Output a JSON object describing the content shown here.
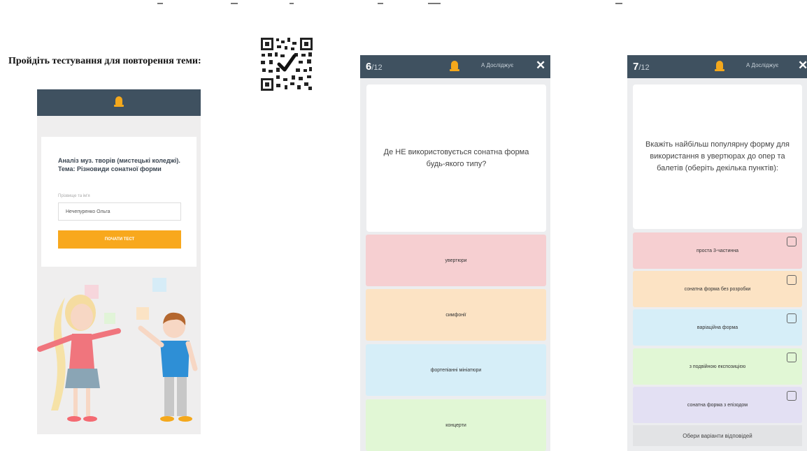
{
  "intro": {
    "text": "Пройдіть тестування для повторення теми:"
  },
  "start_screen": {
    "test_title": "Аналіз муз. творів (мистецькі коледжі). Тема: Різновиди сонатної форми",
    "name_label": "Прізвище та ім'я",
    "name_value": "Нечепуренко Ольга",
    "start_button": "Почати тест"
  },
  "quiz6": {
    "current": "6",
    "total": "/12",
    "user": "А Досліджує",
    "close": "✕",
    "question": "Де НЕ використовується сонатна форма будь-якого типу?",
    "options": [
      {
        "label": "увертюри",
        "color": "#f6cfd1"
      },
      {
        "label": "симфонії",
        "color": "#fce3c4"
      },
      {
        "label": "фортепіанні мініатюри",
        "color": "#d6eef8"
      },
      {
        "label": "концерти",
        "color": "#e1f7d5"
      }
    ]
  },
  "quiz7": {
    "current": "7",
    "total": "/12",
    "user": "А Досліджує",
    "close": "✕",
    "question": "Вкажіть найбільш популярну форму для використання в увертюрах до опер та балетів (оберіть декілька пунктів):",
    "options": [
      {
        "label": "проста 3-частинна",
        "color": "#f6cfd1"
      },
      {
        "label": "сонатна форма без розробки",
        "color": "#fce3c4"
      },
      {
        "label": "варіаційна форма",
        "color": "#d6eef8"
      },
      {
        "label": "з подвійною експозицією",
        "color": "#e1f7d5"
      },
      {
        "label": "сонатна форма з епізодом",
        "color": "#e3e0f3"
      }
    ],
    "hint": "Обери варіанти відповідей"
  },
  "colors": {
    "header": "#3f5160",
    "accent": "#f8a81d",
    "bell": "#f4a81c"
  }
}
